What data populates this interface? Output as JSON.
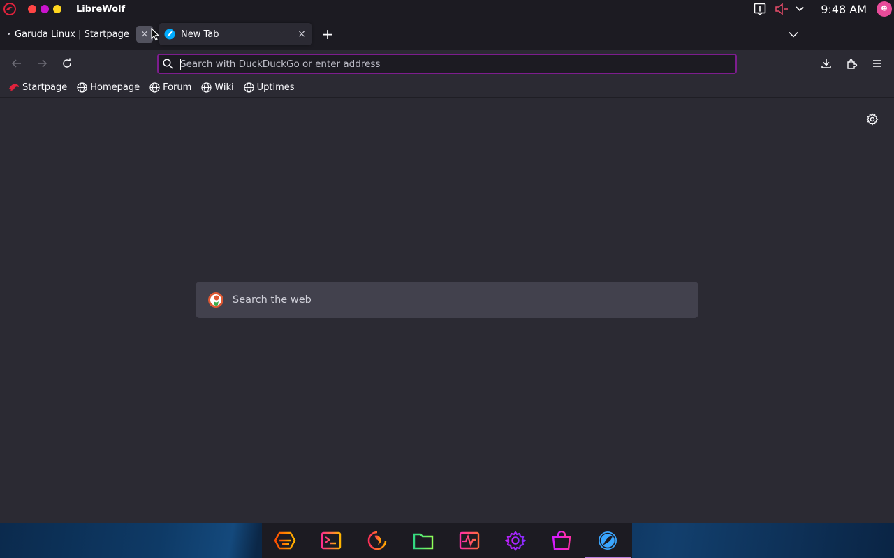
{
  "system_bar": {
    "app_title": "LibreWolf",
    "clock": "9:48 AM",
    "window_dots": [
      "#ff4545",
      "#c913ce",
      "#ffd61f"
    ]
  },
  "tabs": [
    {
      "label": "Garuda Linux | Startpage",
      "close": "×"
    },
    {
      "label": "New Tab",
      "close": "×"
    }
  ],
  "toolbar": {
    "new_tab_label": "+",
    "url_placeholder": "Search with DuckDuckGo or enter address"
  },
  "bookmarks": [
    {
      "label": "Startpage",
      "icon": "garuda-icon"
    },
    {
      "label": "Homepage",
      "icon": "globe-icon"
    },
    {
      "label": "Forum",
      "icon": "globe-icon"
    },
    {
      "label": "Wiki",
      "icon": "globe-icon"
    },
    {
      "label": "Uptimes",
      "icon": "globe-icon"
    }
  ],
  "content": {
    "search_placeholder": "Search the web"
  },
  "dock": {
    "items": [
      "garuda-welcome-icon",
      "terminal-icon",
      "firedragon-icon",
      "files-icon",
      "system-monitor-icon",
      "settings-icon",
      "software-store-icon",
      "librewolf-icon"
    ],
    "active_index": 7
  },
  "colors": {
    "accent": "#7d1d8e",
    "tab_bg": "#1c1b22",
    "content_bg": "#2b2a33"
  }
}
